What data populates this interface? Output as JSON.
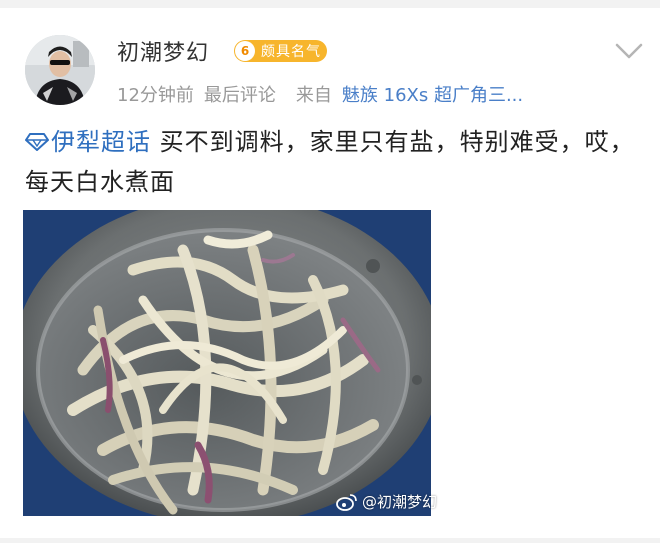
{
  "post": {
    "username": "初潮梦幻",
    "badge": {
      "level": "6",
      "label": "颇具名气"
    },
    "meta": {
      "time": "12分钟前",
      "status": "最后评论",
      "source_prefix": "来自",
      "source_name": "魅族 16Xs 超广角三..."
    },
    "topic": "伊犁超话",
    "body": "买不到调料，家里只有盐，特别难受，哎，每天白水煮面",
    "watermark": "@初潮梦幻"
  },
  "icons": {
    "avatar": "user-avatar",
    "menu": "chevron-down-icon",
    "topic": "super-topic-diamond-icon",
    "watermark": "weibo-logo-icon"
  },
  "colors": {
    "link": "#2f6fbf",
    "source": "#4a7fc8",
    "badge": "#f7b52c",
    "meta": "#999999"
  }
}
